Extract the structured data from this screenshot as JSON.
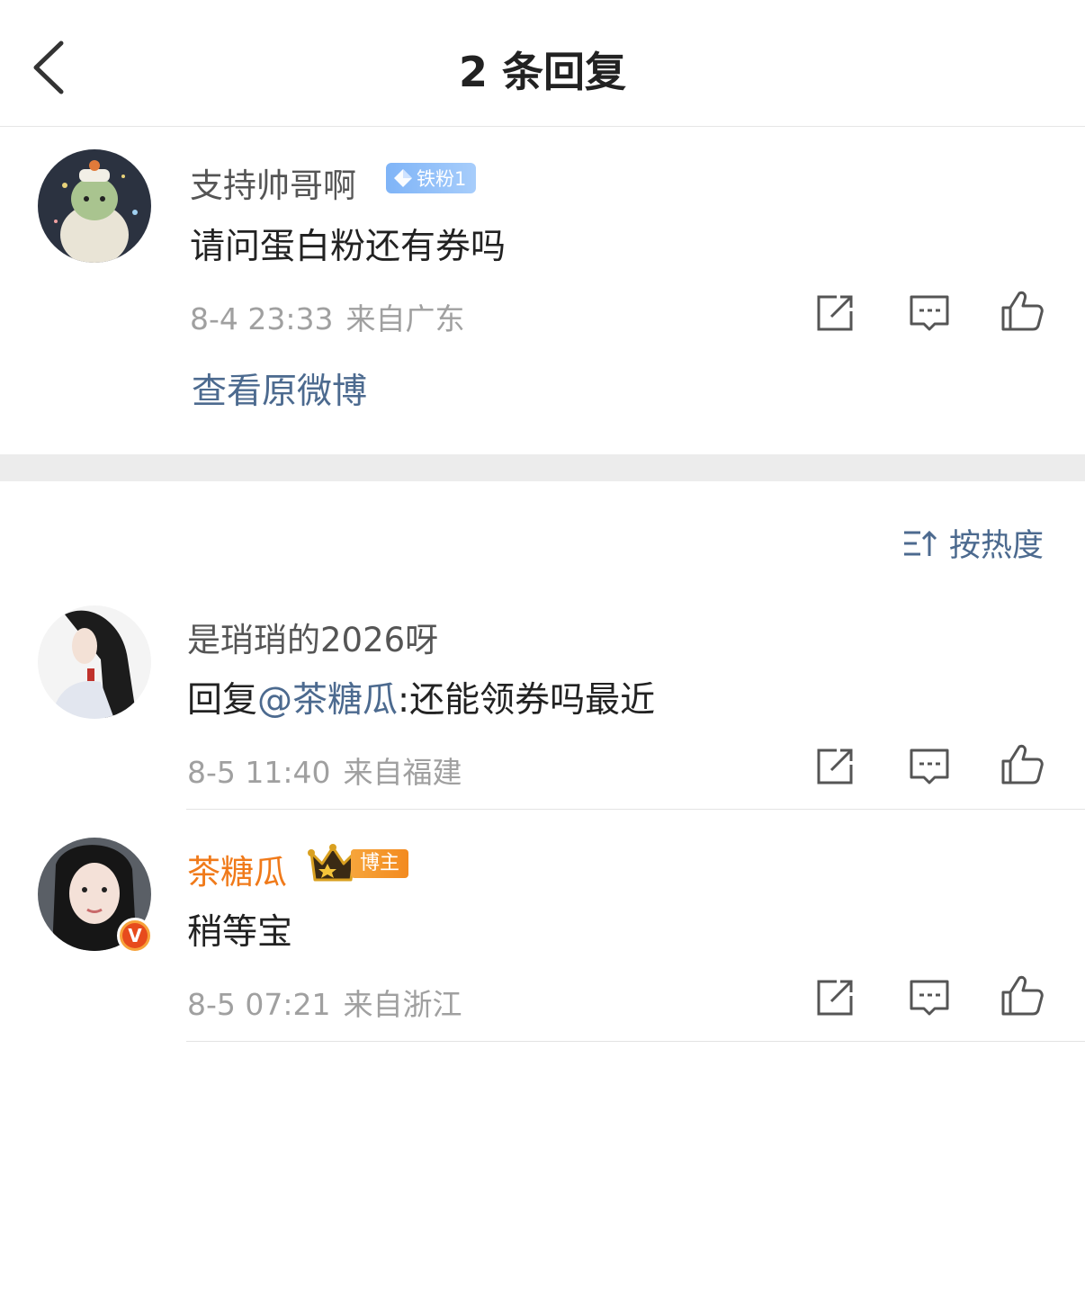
{
  "header": {
    "title": "2 条回复"
  },
  "root_comment": {
    "name": "支持帅哥啊",
    "badge": "铁粉1",
    "text": "请问蛋白粉还有券吗",
    "time": "8-4 23:33",
    "location": "来自广东",
    "view_original": "查看原微博"
  },
  "sort": {
    "label": "按热度"
  },
  "replies": [
    {
      "name": "是琑琑的2026呀",
      "prefix": "回复",
      "mention": "@茶糖瓜",
      "text": ":还能领券吗最近",
      "time": "8-5 11:40",
      "location": "来自福建"
    },
    {
      "name": "茶糖瓜",
      "badge": "博主",
      "verified_mark": "V",
      "text": "稍等宝",
      "time": "8-5 07:21",
      "location": "来自浙江"
    }
  ],
  "colors": {
    "link": "#4c6a8f",
    "blogger": "#f07a1a",
    "meta": "#a0a0a0"
  },
  "icons": [
    "chevron-left-icon",
    "share-icon",
    "comment-icon",
    "like-icon",
    "sort-icon",
    "diamond-icon",
    "crown-icon",
    "verified-icon"
  ]
}
